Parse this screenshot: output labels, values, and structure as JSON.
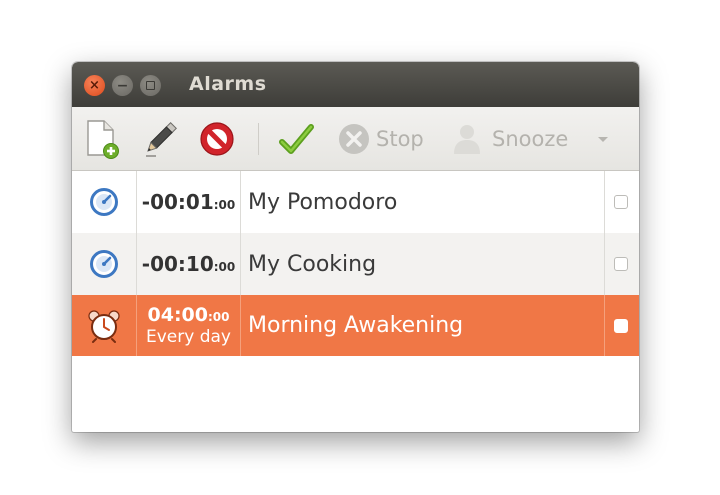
{
  "window": {
    "title": "Alarms"
  },
  "toolbar": {
    "new_icon": "new-alarm-icon",
    "edit_icon": "edit-pencil-icon",
    "delete_icon": "delete-icon",
    "enable_icon": "checkmark-icon",
    "stop_label": "Stop",
    "snooze_label": "Snooze"
  },
  "alarms": [
    {
      "icon": "timer-icon",
      "time_main": "-00:01",
      "time_sec": ":00",
      "repeat": "",
      "name": "My Pomodoro",
      "selected": false,
      "checked": false
    },
    {
      "icon": "timer-icon",
      "time_main": "-00:10",
      "time_sec": ":00",
      "repeat": "",
      "name": "My Cooking",
      "selected": false,
      "checked": false
    },
    {
      "icon": "alarm-clock-icon",
      "time_main": "04:00",
      "time_sec": ":00",
      "repeat": "Every day",
      "name": "Morning Awakening",
      "selected": true,
      "checked": false
    }
  ],
  "colors": {
    "selection": "#f07746",
    "titlebar": "#4a4945",
    "close_button": "#e9612e",
    "timer_icon": "#3d78c2"
  }
}
